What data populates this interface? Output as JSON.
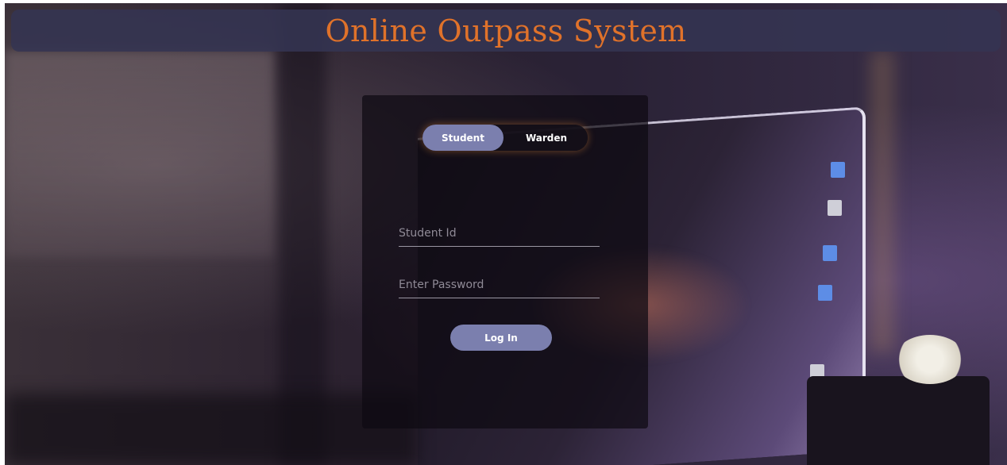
{
  "app": {
    "title": "Online Outpass System",
    "title_color": "#e0722a"
  },
  "login_card": {
    "role_toggle": {
      "options": [
        "Student",
        "Warden"
      ],
      "selected": "Student",
      "active_color": "#7b7fae"
    },
    "student_id": {
      "placeholder": "Student Id",
      "value": ""
    },
    "password": {
      "placeholder": "Enter Password",
      "value": ""
    },
    "login_button_label": "Log In"
  },
  "background": {
    "description_icon": "laptop-photo-background"
  }
}
